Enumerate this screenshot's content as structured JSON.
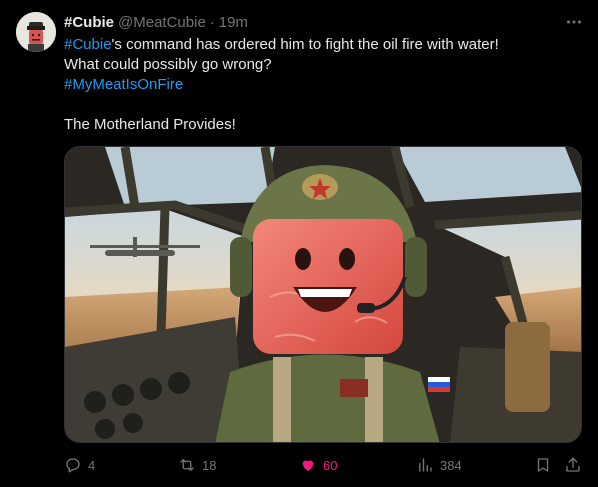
{
  "author": {
    "display_name": "#Cubie",
    "handle": "@MeatCubie",
    "separator": "·",
    "time": "19m"
  },
  "tweet": {
    "line1_hashtag": "#Cubie",
    "line1_rest": "'s command has ordered him to fight the oil fire with water!",
    "line2": "What could possibly go wrong?",
    "line3_hashtag": "#MyMeatIsOnFire",
    "line5": "The Motherland Provides!"
  },
  "actions": {
    "replies": "4",
    "retweets": "18",
    "likes": "60",
    "views": "384"
  },
  "icons": {
    "more": "more-dots-icon",
    "reply": "reply-icon",
    "retweet": "retweet-icon",
    "like": "heart-icon",
    "views": "views-chart-icon",
    "bookmark": "bookmark-icon",
    "share": "share-icon"
  },
  "colors": {
    "background": "#000000",
    "text": "#e7e9ea",
    "muted": "#71767b",
    "hashtag": "#1d9bf0",
    "like": "#f91880"
  }
}
